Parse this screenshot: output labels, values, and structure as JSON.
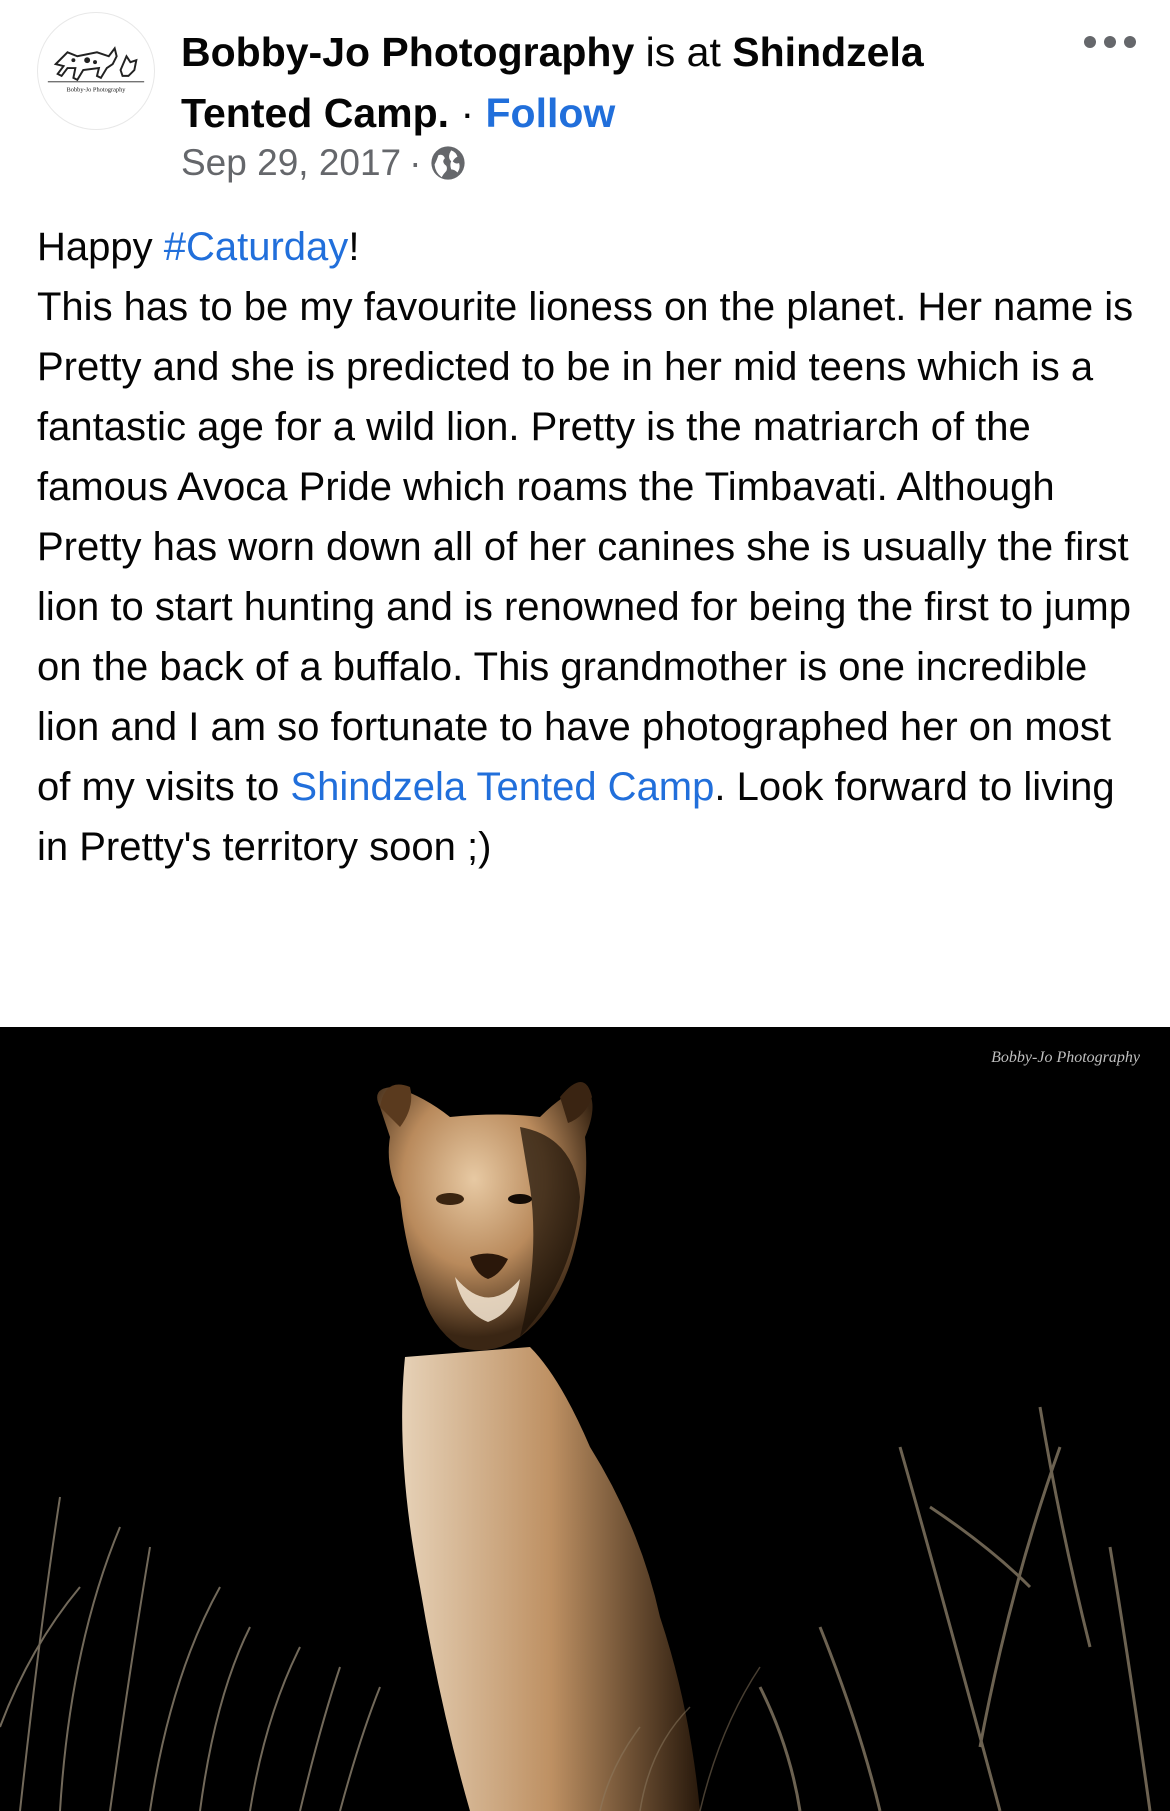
{
  "post": {
    "author": "Bobby-Jo Photography",
    "is_at": "is at",
    "location": "Shindzela Tented Camp.",
    "separator": "·",
    "follow_label": "Follow",
    "date": "Sep 29, 2017",
    "date_separator": "·",
    "audience_icon": "globe-icon",
    "more_icon": "more-options-icon",
    "avatar_text": "Bobby-Jo Photography"
  },
  "body": {
    "line1_prefix": "Happy ",
    "hashtag": "#Caturday",
    "line1_suffix": "!",
    "paragraph_main": "This has to be my favourite lioness on the planet. Her name is Pretty and she is predicted to be in her mid teens which is a fantastic age for a wild lion. Pretty is the matriarch of the famous Avoca Pride which roams the Timbavati. Although Pretty has worn down all of her canines she is usually the first lion to start hunting and is renowned for being the first to jump on the back of a buffalo. This grandmother is one incredible lion and I am so fortunate to have photographed her on most of my visits to ",
    "camp_link": "Shindzela Tented Camp",
    "paragraph_end": ". Look forward to living in Pretty's territory soon ;)"
  },
  "photo": {
    "watermark": "Bobby-Jo Photography",
    "subject": "lioness"
  },
  "colors": {
    "link": "#216fdb",
    "meta": "#65676b",
    "text": "#050505",
    "photo_bg": "#000000"
  }
}
